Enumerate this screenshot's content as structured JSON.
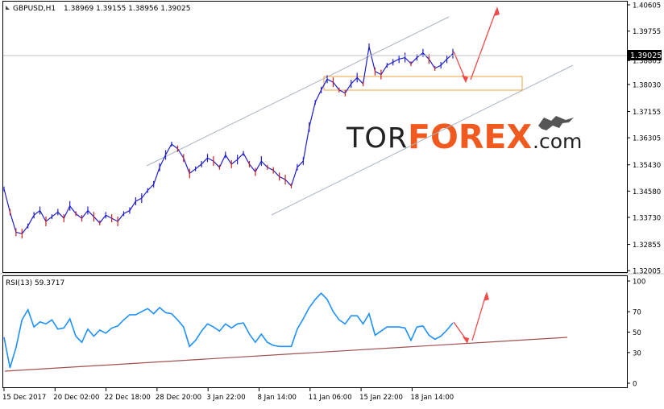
{
  "header": {
    "symbol": "GBPUSD,H1",
    "ohlc": "1.38969 1.39155 1.38956 1.39025"
  },
  "rsi": {
    "label": "RSI(13) 59.3717",
    "levels": [
      100,
      70,
      50,
      30,
      0
    ]
  },
  "watermark": {
    "part1": "TOR",
    "part2": "FOREX",
    "part3": ".com"
  },
  "current_price": "1.39025",
  "colors": {
    "background": "#ffffff",
    "grid": "#c0c0c0",
    "up_candle": "#1f1fd0",
    "down_candle": "#c81e1e",
    "channel": "#a9b4c2",
    "zone": "#f2a040",
    "arrow": "#f04a4a",
    "rsi_line": "#1e90ff",
    "rsi_trend": "#a05050",
    "watermark_dark": "#222222",
    "watermark_accent": "#f05a1e"
  },
  "chart_data": [
    {
      "type": "line",
      "title": "",
      "ylim": [
        1.3201,
        1.40605
      ],
      "y_ticks": [
        "1.40605",
        "1.39755",
        "1.38803",
        "1.38030",
        "1.37155",
        "1.36305",
        "1.35430",
        "1.34580",
        "1.33730",
        "1.32855",
        "1.32005"
      ],
      "x_ticks": [
        "15 Dec 2017",
        "20 Dec 02:00",
        "22 Dec 18:00",
        "28 Dec 20:00",
        "3 Jan 22:00",
        "8 Jan 14:00",
        "11 Jan 06:00",
        "15 Jan 22:00",
        "18 Jan 14:00"
      ],
      "series": [
        {
          "values": [
            1.3465,
            1.339,
            1.3325,
            1.332,
            1.3345,
            1.338,
            1.3395,
            1.336,
            1.3375,
            1.339,
            1.337,
            1.341,
            1.3385,
            1.337,
            1.3395,
            1.3375,
            1.3355,
            1.338,
            1.337,
            1.336,
            1.3385,
            1.3395,
            1.3425,
            1.3435,
            1.346,
            1.348,
            1.3535,
            1.3575,
            1.361,
            1.3595,
            1.3565,
            1.3515,
            1.353,
            1.3545,
            1.3565,
            1.3555,
            1.3535,
            1.3575,
            1.3545,
            1.356,
            1.358,
            1.3545,
            1.352,
            1.3555,
            1.3535,
            1.3525,
            1.3505,
            1.3495,
            1.3475,
            1.3535,
            1.3555,
            1.3665,
            1.3745,
            1.3785,
            1.382,
            1.381,
            1.3785,
            1.3775,
            1.3805,
            1.3825,
            1.3805,
            1.3925,
            1.3845,
            1.3835,
            1.3865,
            1.3875,
            1.3885,
            1.389,
            1.387,
            1.389,
            1.3905,
            1.3885,
            1.3855,
            1.3865,
            1.3885,
            1.39025
          ]
        }
      ]
    },
    {
      "type": "line",
      "title": "",
      "ylim": [
        0,
        100
      ],
      "series": [
        {
          "values": [
            45,
            15,
            35,
            62,
            72,
            55,
            60,
            58,
            62,
            53,
            54,
            63,
            46,
            40,
            53,
            46,
            52,
            49,
            54,
            56,
            62,
            67,
            67,
            70,
            73,
            68,
            74,
            69,
            68,
            62,
            55,
            36,
            42,
            51,
            58,
            55,
            51,
            58,
            54,
            58,
            59,
            48,
            40,
            48,
            40,
            37,
            36,
            36,
            36,
            53,
            63,
            74,
            82,
            88,
            82,
            70,
            62,
            58,
            66,
            66,
            58,
            68,
            47,
            51,
            55,
            55,
            55,
            54,
            42,
            55,
            56,
            47,
            43,
            46,
            52,
            59
          ]
        }
      ]
    }
  ]
}
